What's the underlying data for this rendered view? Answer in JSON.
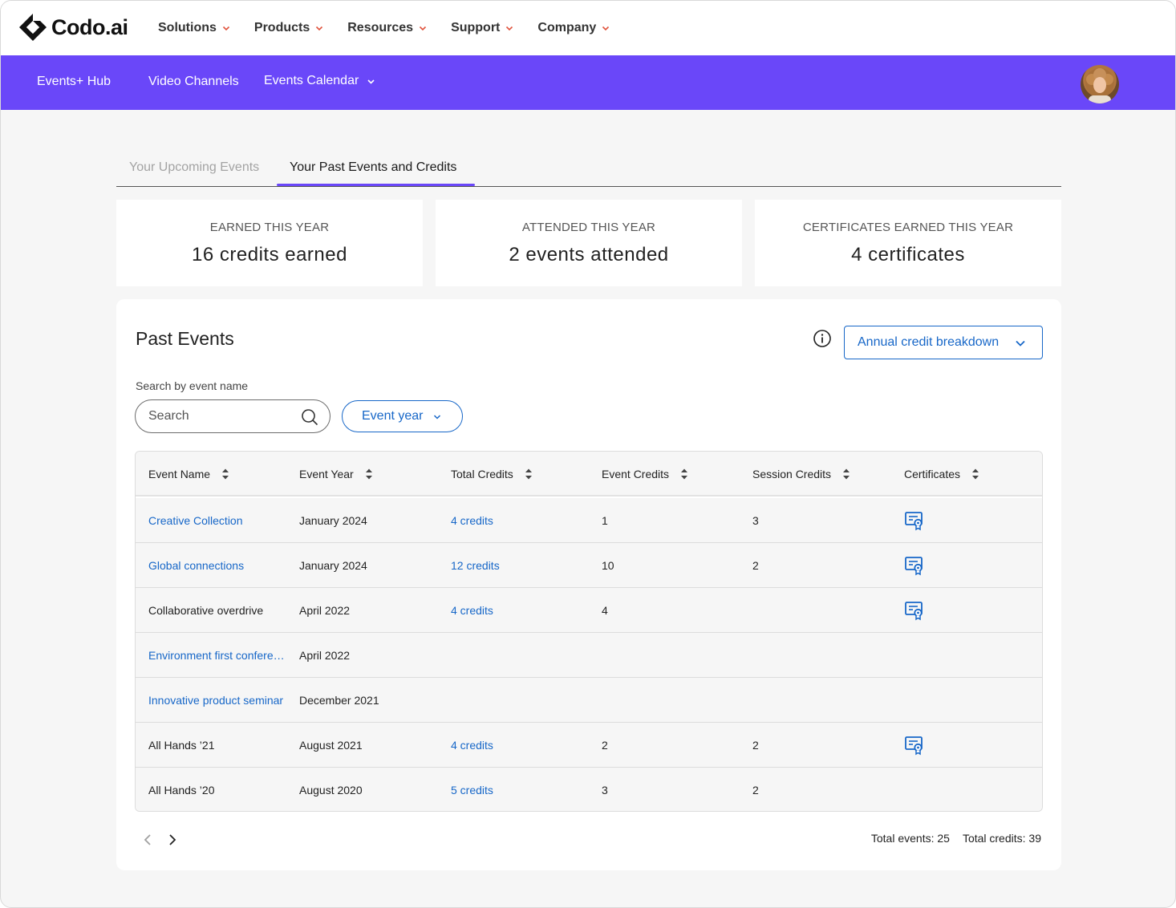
{
  "brand": {
    "name": "Codo.ai"
  },
  "topnav": {
    "items": [
      {
        "label": "Solutions"
      },
      {
        "label": "Products"
      },
      {
        "label": "Resources"
      },
      {
        "label": "Support"
      },
      {
        "label": "Company"
      }
    ]
  },
  "subnav": {
    "hub": "Events+ Hub",
    "channels": "Video Channels",
    "calendar": "Events Calendar"
  },
  "tabs": {
    "upcoming": "Your Upcoming Events",
    "past": "Your Past Events and Credits"
  },
  "stats": [
    {
      "label": "EARNED THIS YEAR",
      "value": "16 credits earned"
    },
    {
      "label": "ATTENDED THIS YEAR",
      "value": "2 events attended"
    },
    {
      "label": "CERTIFICATES EARNED THIS YEAR",
      "value": "4 certificates"
    }
  ],
  "panel": {
    "title": "Past Events",
    "breakdown_label": "Annual credit breakdown",
    "search_label": "Search by event name",
    "search_placeholder": "Search",
    "year_filter": "Event year"
  },
  "table": {
    "columns": [
      "Event Name",
      "Event Year",
      "Total Credits",
      "Event Credits",
      "Session Credits",
      "Certificates"
    ],
    "rows": [
      {
        "name": "Creative Collection",
        "name_link": true,
        "year": "January 2024",
        "total": "4 credits",
        "event": "1",
        "session": "3",
        "cert": true
      },
      {
        "name": "Global connections",
        "name_link": true,
        "year": "January 2024",
        "total": "12 credits",
        "event": "10",
        "session": "2",
        "cert": true
      },
      {
        "name": "Collaborative overdrive",
        "name_link": false,
        "year": "April 2022",
        "total": "4 credits",
        "event": "4",
        "session": "",
        "cert": true
      },
      {
        "name": "Environment first conference",
        "name_link": true,
        "year": "April 2022",
        "total": "",
        "event": "",
        "session": "",
        "cert": false
      },
      {
        "name": "Innovative product seminar",
        "name_link": true,
        "year": "December 2021",
        "total": "",
        "event": "",
        "session": "",
        "cert": false
      },
      {
        "name": "All Hands ’21",
        "name_link": false,
        "year": "August 2021",
        "total": "4 credits",
        "event": "2",
        "session": "2",
        "cert": true
      },
      {
        "name": "All Hands ’20",
        "name_link": false,
        "year": "August 2020",
        "total": "5 credits",
        "event": "3",
        "session": "2",
        "cert": false
      }
    ]
  },
  "footer": {
    "total_events": "Total events: 25",
    "total_credits": "Total credits: 39"
  },
  "colors": {
    "accent": "#6a47f9",
    "link": "#1767c8",
    "menu_chevron": "#e0533d"
  }
}
